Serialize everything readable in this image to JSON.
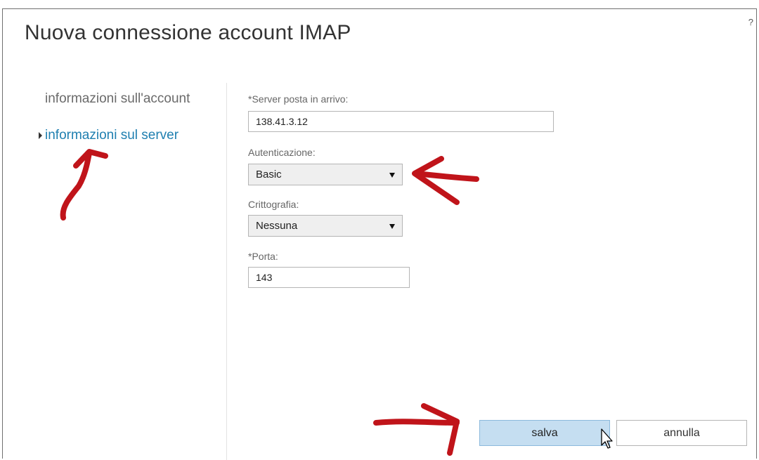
{
  "dialog": {
    "title": "Nuova connessione account IMAP",
    "help": "?"
  },
  "nav": {
    "items": [
      {
        "label": "informazioni sull'account",
        "active": false
      },
      {
        "label": "informazioni sul server",
        "active": true
      }
    ]
  },
  "form": {
    "incoming_server": {
      "label": "*Server posta in arrivo:",
      "value": "138.41.3.12"
    },
    "authentication": {
      "label": "Autenticazione:",
      "selected": "Basic"
    },
    "encryption": {
      "label": "Crittografia:",
      "selected": "Nessuna"
    },
    "port": {
      "label": "*Porta:",
      "value": "143"
    }
  },
  "buttons": {
    "save": "salva",
    "cancel": "annulla"
  },
  "colors": {
    "annotation_arrow": "#c0141a",
    "active_nav": "#1f7fb0",
    "save_button_bg": "#c5def1"
  }
}
